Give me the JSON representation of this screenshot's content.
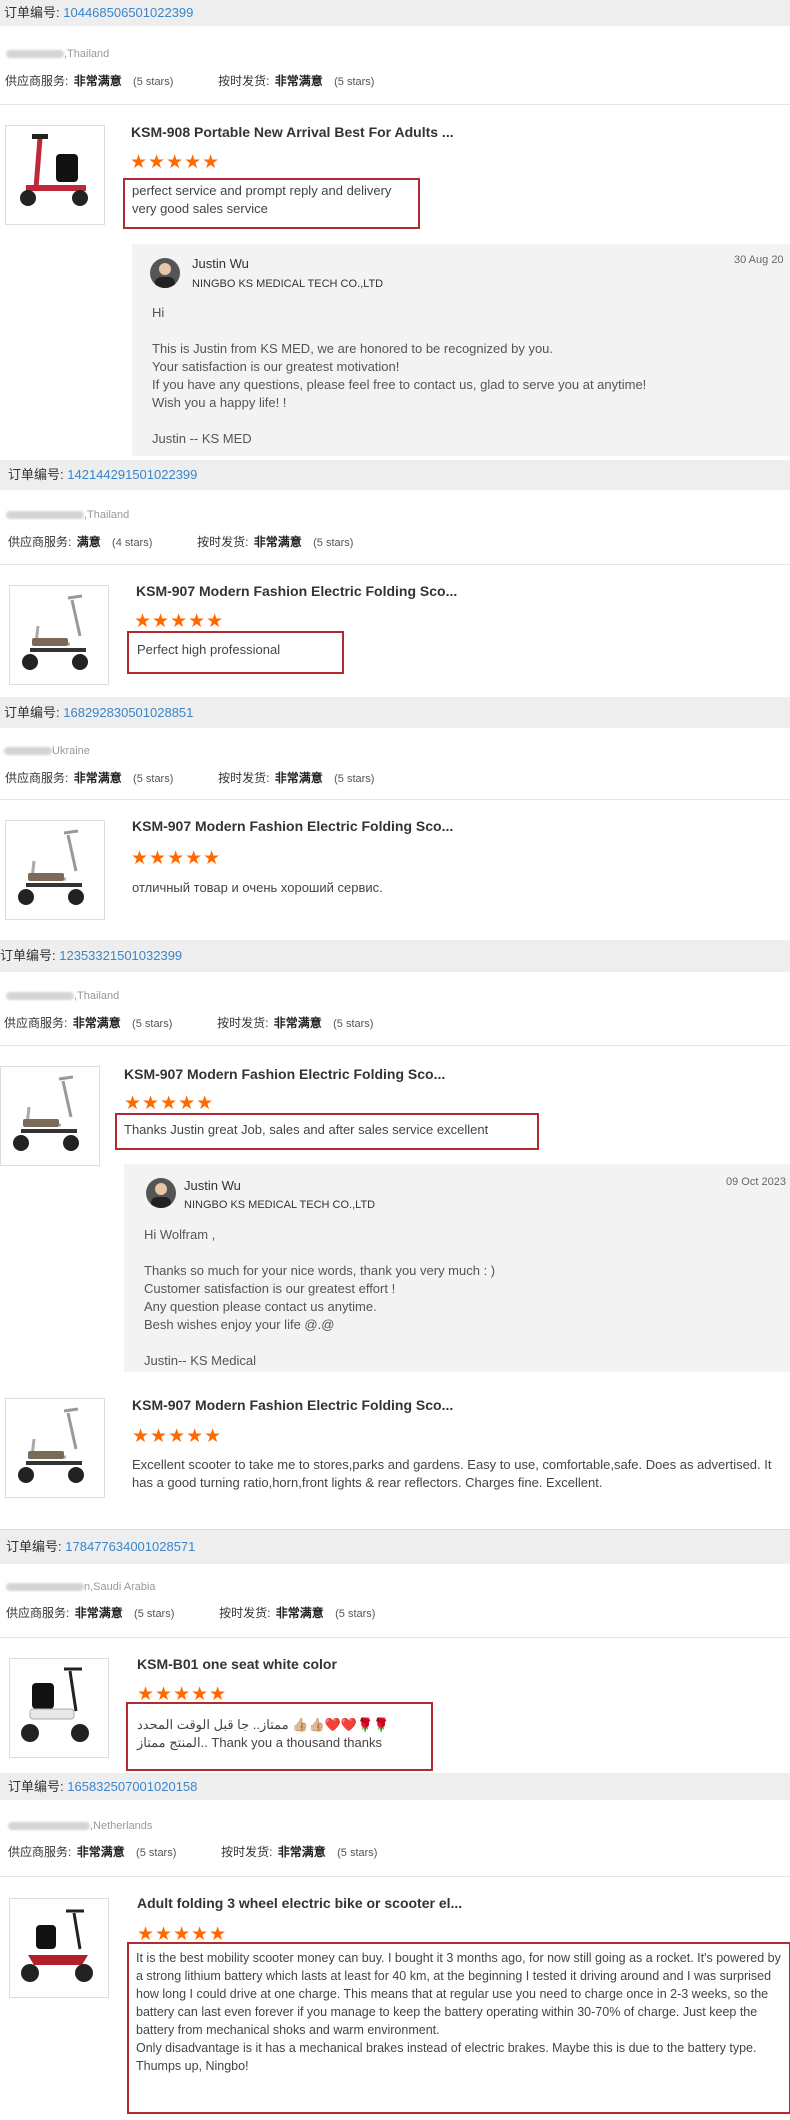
{
  "labels": {
    "order_prefix": "订单编号:",
    "supplier_service": "供应商服务:",
    "shipping": "按时发货:"
  },
  "orders": [
    {
      "order_number": "1044685065010223​99",
      "customer_country": ",Thailand",
      "supplier_rating": "非常满意",
      "supplier_stars": "(5 stars)",
      "shipping_rating": "非常满意",
      "shipping_stars": "(5 stars)",
      "product_title": "KSM-908 Portable New Arrival Best For Adults ...",
      "stars": "★★★★★",
      "review": "perfect service and prompt reply and delivery\nvery good sales service",
      "reply": {
        "name": "Justin Wu",
        "company": "NINGBO KS MEDICAL TECH CO.,LTD",
        "date": "30 Aug 20",
        "body": "Hi \n\nThis is Justin from KS MED, we are honored to be recognized by you.\nYour satisfaction is our greatest motivation!\nIf you have any questions, please feel free to contact us, glad to serve you at anytime!\nWish you a happy life!  !\n\nJustin -- KS MED"
      }
    },
    {
      "order_number": "142144291501022399",
      "customer_country": ",Thailand",
      "supplier_rating": "满意",
      "supplier_stars": "(4 stars)",
      "shipping_rating": "非常满意",
      "shipping_stars": "(5 stars)",
      "product_title": "KSM-907 Modern Fashion Electric Folding Sco...",
      "stars": "★★★★★",
      "review": "Perfect high professional"
    },
    {
      "order_number": "168292830501028851",
      "customer_country": "Ukraine",
      "supplier_rating": "非常满意",
      "supplier_stars": "(5 stars)",
      "shipping_rating": "非常满意",
      "shipping_stars": "(5 stars)",
      "product_title": "KSM-907 Modern Fashion Electric Folding Sco...",
      "stars": "★★★★★",
      "review": "отличный товар и очень хороший сервис."
    },
    {
      "order_number": "12353321501032399",
      "customer_country": ",Thailand",
      "supplier_rating": "非常满意",
      "supplier_stars": "(5 stars)",
      "shipping_rating": "非常满意",
      "shipping_stars": "(5 stars)",
      "product_title": "KSM-907 Modern Fashion Electric Folding Sco...",
      "stars": "★★★★★",
      "review": "Thanks Justin great Job, sales and after sales service excellent",
      "reply": {
        "name": "Justin Wu",
        "company": "NINGBO KS MEDICAL TECH CO.,LTD",
        "date": "09 Oct 2023",
        "body": "Hi Wolfram ,\n\nThanks so much for your nice words, thank you very much : )\nCustomer satisfaction is our greatest effort !\nAny question please contact us anytime.\nBesh wishes enjoy your life @.@\n\nJustin-- KS Medical"
      },
      "product2_title": "KSM-907 Modern Fashion Electric Folding Sco...",
      "stars2": "★★★★★",
      "review2": "Excellent scooter to take me to stores,parks and gardens. Easy to use, comfortable,safe. Does as advertised. It has a good turning ratio,horn,front lights & rear reflectors. Charges fine. Excellent."
    },
    {
      "order_number": "178477634001028571",
      "customer_country": "n,Saudi Arabia",
      "supplier_rating": "非常满意",
      "supplier_stars": "(5 stars)",
      "shipping_rating": "非常满意",
      "shipping_stars": "(5 stars)",
      "product_title": "KSM-B01 one seat white color",
      "stars": "★★★★★",
      "review": "ممتاز.. جا قبل الوقت المحدد 👍🏼👍🏼❤️❤️🌹🌹\nالمنتج ممتاز.. Thank you a thousand thanks"
    },
    {
      "order_number": "165832507001020158",
      "customer_country": ",Netherlands",
      "supplier_rating": "非常满意",
      "supplier_stars": "(5 stars)",
      "shipping_rating": "非常满意",
      "shipping_stars": "(5 stars)",
      "product_title": "Adult folding 3 wheel electric bike or scooter el...",
      "stars": "★★★★★",
      "review": "It is the best mobility scooter money can buy. I bought it 3 months ago, for now still going as a rocket. It's powered by a strong lithium battery which lasts at least for 40 km, at the beginning I tested it driving around and I was surprised how long I could drive at one charge. This means that at regular use you need to charge once in 2-3 weeks, so the battery can last even forever if you manage to keep the battery operating within 30-70% of charge. Just keep the battery from mechanical shoks and warm environment.\nOnly disadvantage is it has a mechanical brakes instead of electric brakes. Maybe this is due to the battery type.\nThumps up, Ningbo!"
    }
  ]
}
